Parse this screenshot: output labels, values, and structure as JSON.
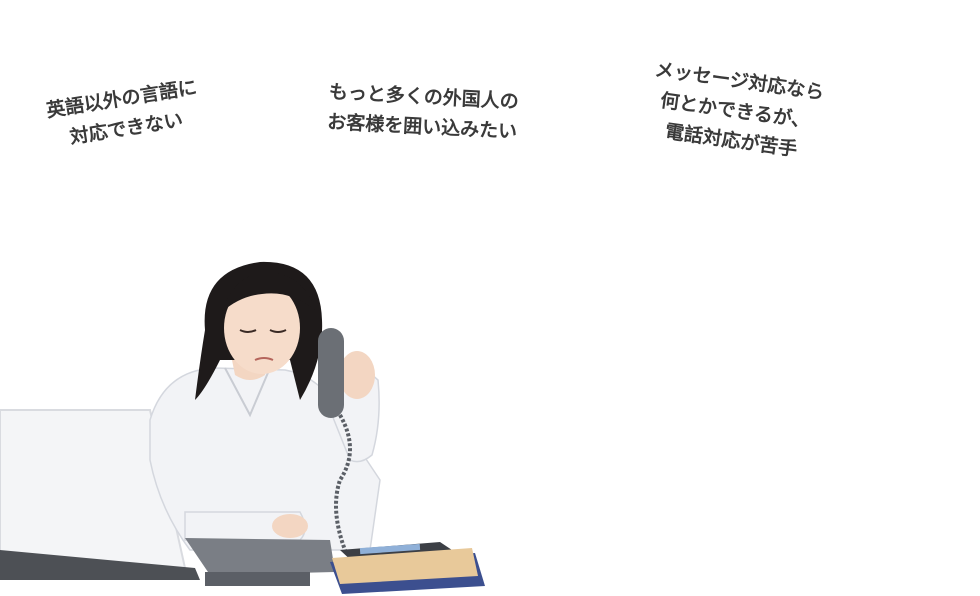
{
  "bubbles": [
    {
      "lines": [
        "英語以外の言語に",
        "対応できない"
      ]
    },
    {
      "lines": [
        "もっと多くの外国人の",
        "お客様を囲い込みたい"
      ]
    },
    {
      "lines": [
        "メッセージ対応なら",
        "何とかできるが、",
        "電話対応が苦手"
      ]
    }
  ],
  "colors": {
    "text": "#3a3a3a",
    "background": "#ffffff",
    "hair": "#1e1a1a",
    "shirt": "#f2f3f6",
    "phone": "#6b6f75",
    "folder_blue": "#3c4f8f",
    "folder_yellow": "#e8c99a"
  },
  "illustration": {
    "name": "woman-on-phone-worried"
  }
}
